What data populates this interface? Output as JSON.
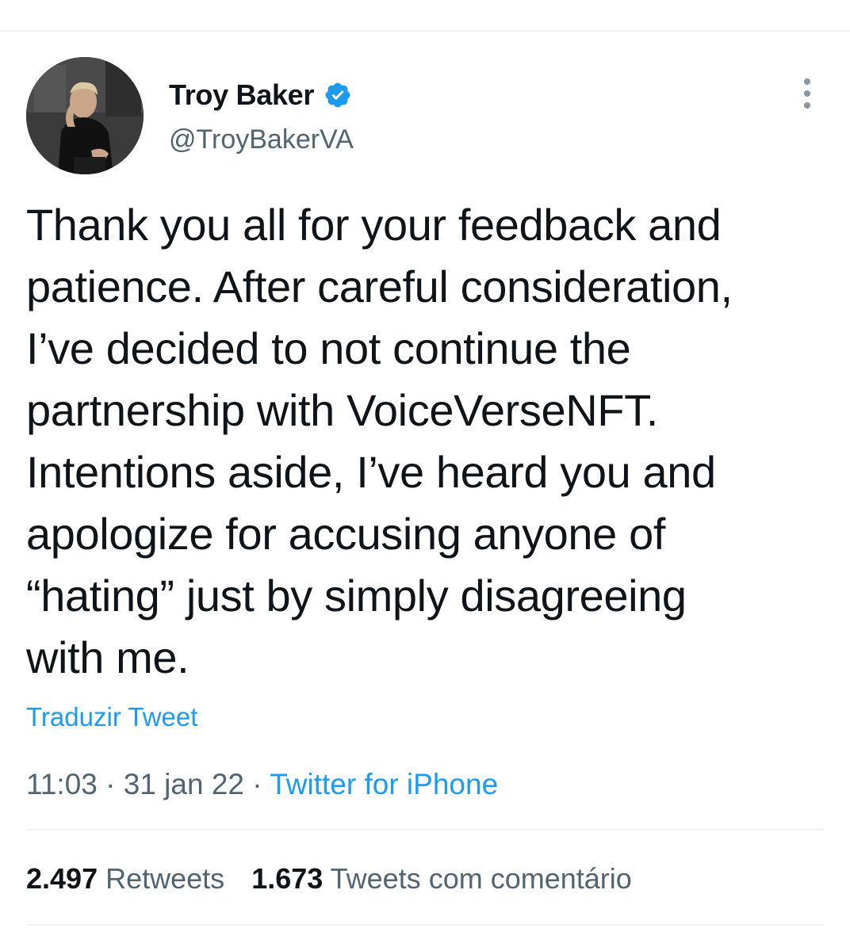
{
  "author": {
    "display_name": "Troy Baker",
    "handle": "@TroyBakerVA",
    "verified": true,
    "verified_color": "#1d9bf0"
  },
  "tweet": {
    "text": "Thank you all for your feedback and\npatience. After careful consideration,\nI’ve decided to not continue the\npartnership with VoiceVerseNFT.\nIntentions aside, I’ve heard you and\napologize for accusing anyone of\n“hating” just by simply disagreeing\nwith me.",
    "translate_label": "Traduzir Tweet",
    "time": "11:03",
    "separator": "·",
    "date": "31 jan 22",
    "source": "Twitter for iPhone"
  },
  "stats": {
    "retweets_count": "2.497",
    "retweets_label": "Retweets",
    "quotes_count": "1.673",
    "quotes_label": "Tweets com comentário"
  },
  "colors": {
    "accent": "#1d9bf0",
    "secondary_text": "#536471",
    "primary_text": "#0f1419"
  },
  "icons": {
    "verified": "verified-badge-icon",
    "more": "more-vertical-icon"
  }
}
